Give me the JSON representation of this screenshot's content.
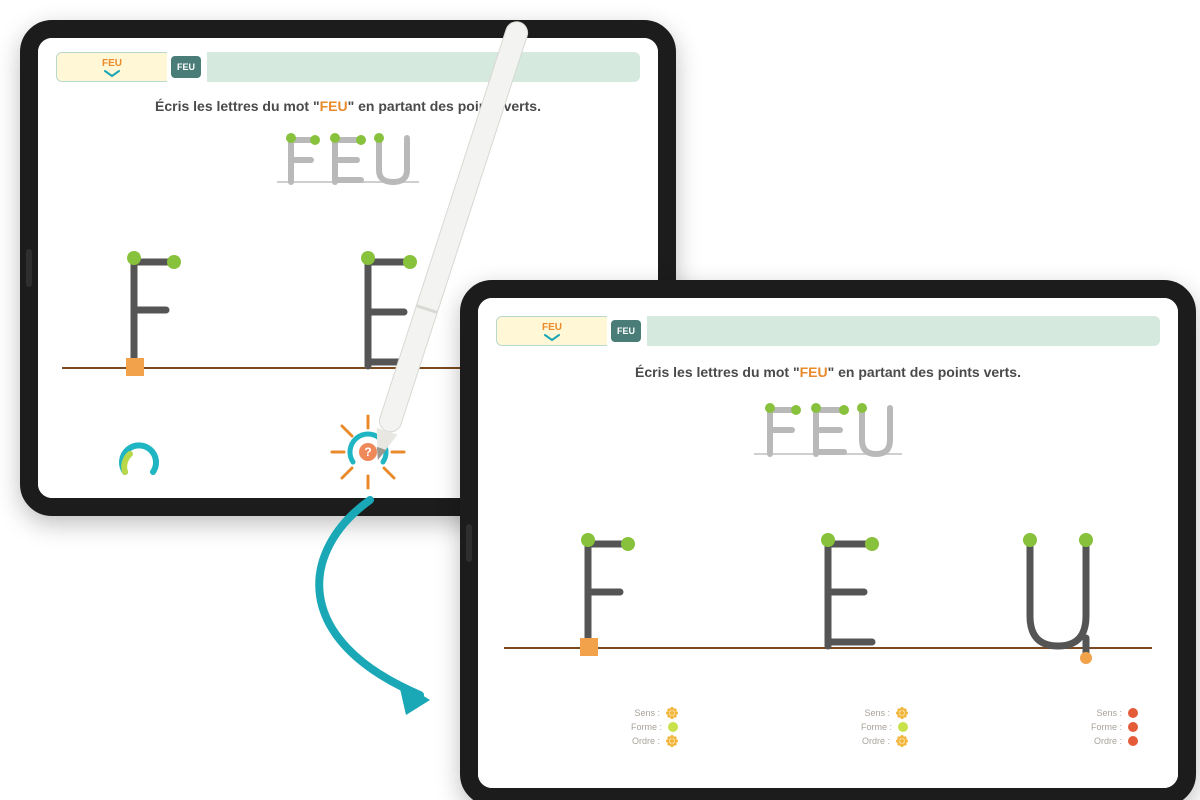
{
  "word": "FEU",
  "word_button": "FEU",
  "instruction_pre": "Écris les lettres du mot \"",
  "instruction_post": "\" en partant des points verts.",
  "hint_icon": "?",
  "feedback": {
    "sens": "Sens :",
    "forme": "Forme :",
    "ordre": "Ordre :"
  },
  "letters": {
    "F": {
      "states_b": [
        "flower",
        "yellow",
        "flower"
      ]
    },
    "E": {
      "states_b": [
        "flower",
        "yellow",
        "flower"
      ]
    },
    "U": {
      "states_b": [
        "red",
        "red",
        "red"
      ]
    }
  }
}
